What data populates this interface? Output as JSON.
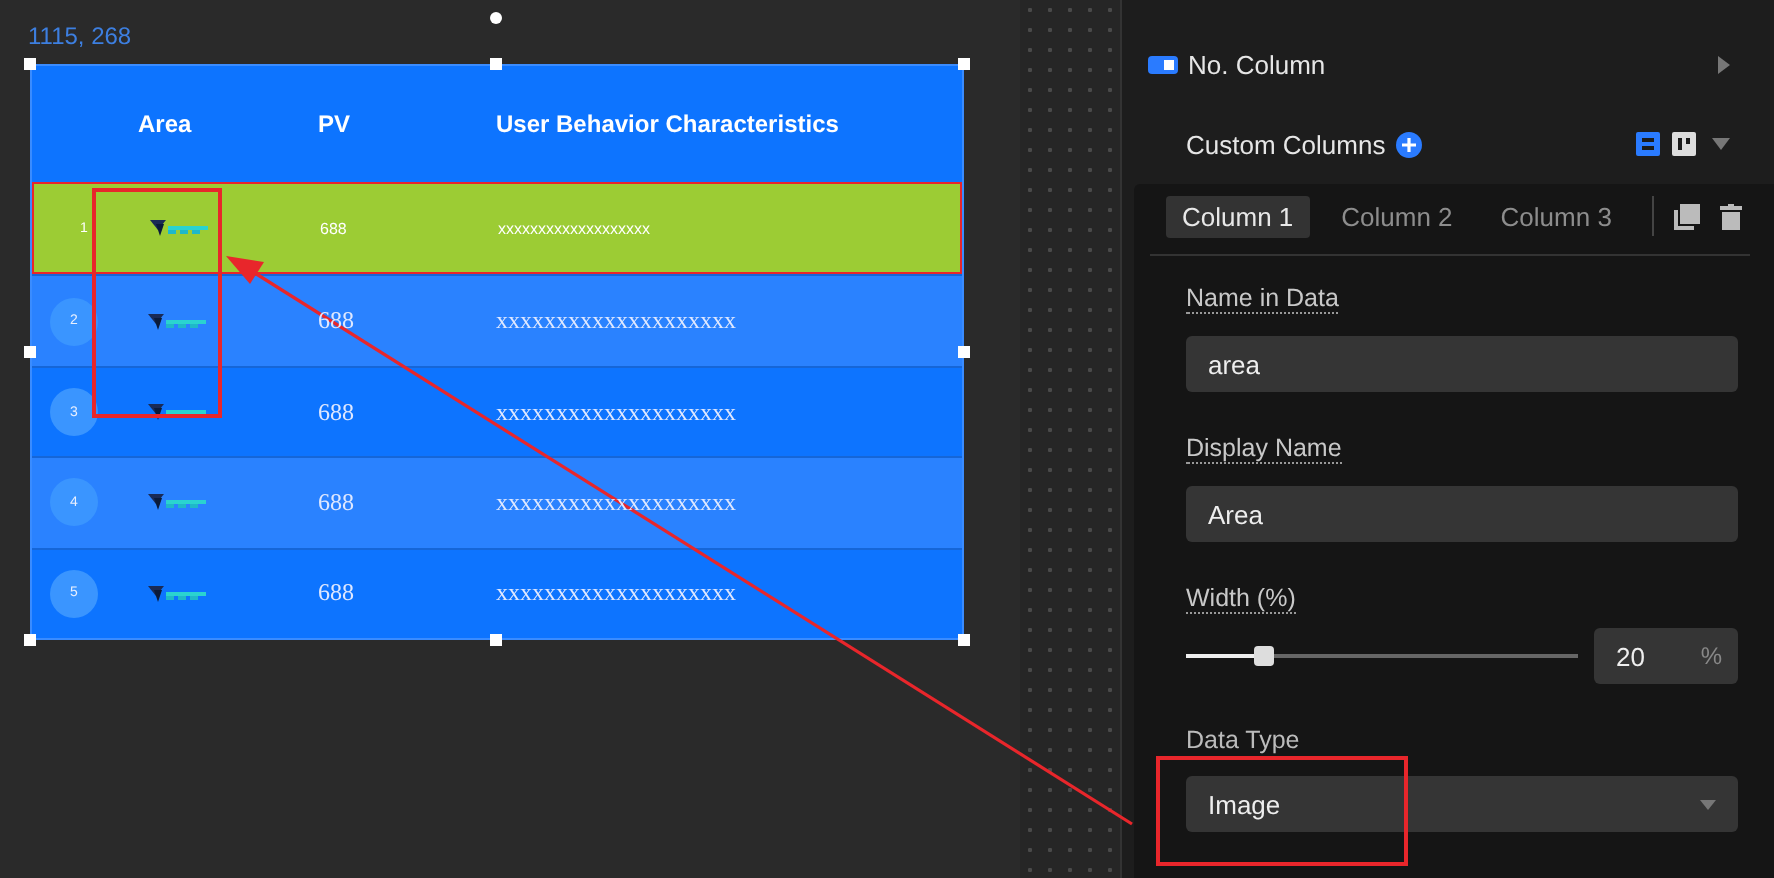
{
  "canvas": {
    "coordinates": "1115, 268",
    "table": {
      "columns": [
        "Area",
        "PV",
        "User Behavior Characteristics"
      ],
      "rows": [
        {
          "index": "1",
          "pv": "688",
          "description": "xxxxxxxxxxxxxxxxxxx",
          "selected": true
        },
        {
          "index": "2",
          "pv": "688",
          "description": "xxxxxxxxxxxxxxxxxxxx",
          "selected": false
        },
        {
          "index": "3",
          "pv": "688",
          "description": "xxxxxxxxxxxxxxxxxxxx",
          "selected": false
        },
        {
          "index": "4",
          "pv": "688",
          "description": "xxxxxxxxxxxxxxxxxxxx",
          "selected": false
        },
        {
          "index": "5",
          "pv": "688",
          "description": "xxxxxxxxxxxxxxxxxxxx",
          "selected": false
        }
      ]
    }
  },
  "panel": {
    "no_column": {
      "label": "No. Column",
      "on": true
    },
    "custom_columns": {
      "label": "Custom Columns"
    },
    "tabs": [
      {
        "label": "Column 1",
        "selected": true
      },
      {
        "label": "Column 2",
        "selected": false
      },
      {
        "label": "Column 3",
        "selected": false
      }
    ],
    "fields": [
      {
        "kind": "text",
        "label": "Name in Data",
        "value": "area"
      },
      {
        "kind": "text",
        "label": "Display Name",
        "value": "Area"
      },
      {
        "kind": "slider",
        "label": "Width (%)",
        "level": 0.2,
        "value": "20",
        "unit": "%"
      },
      {
        "kind": "select",
        "label": "Data Type",
        "value": "Image"
      }
    ]
  }
}
